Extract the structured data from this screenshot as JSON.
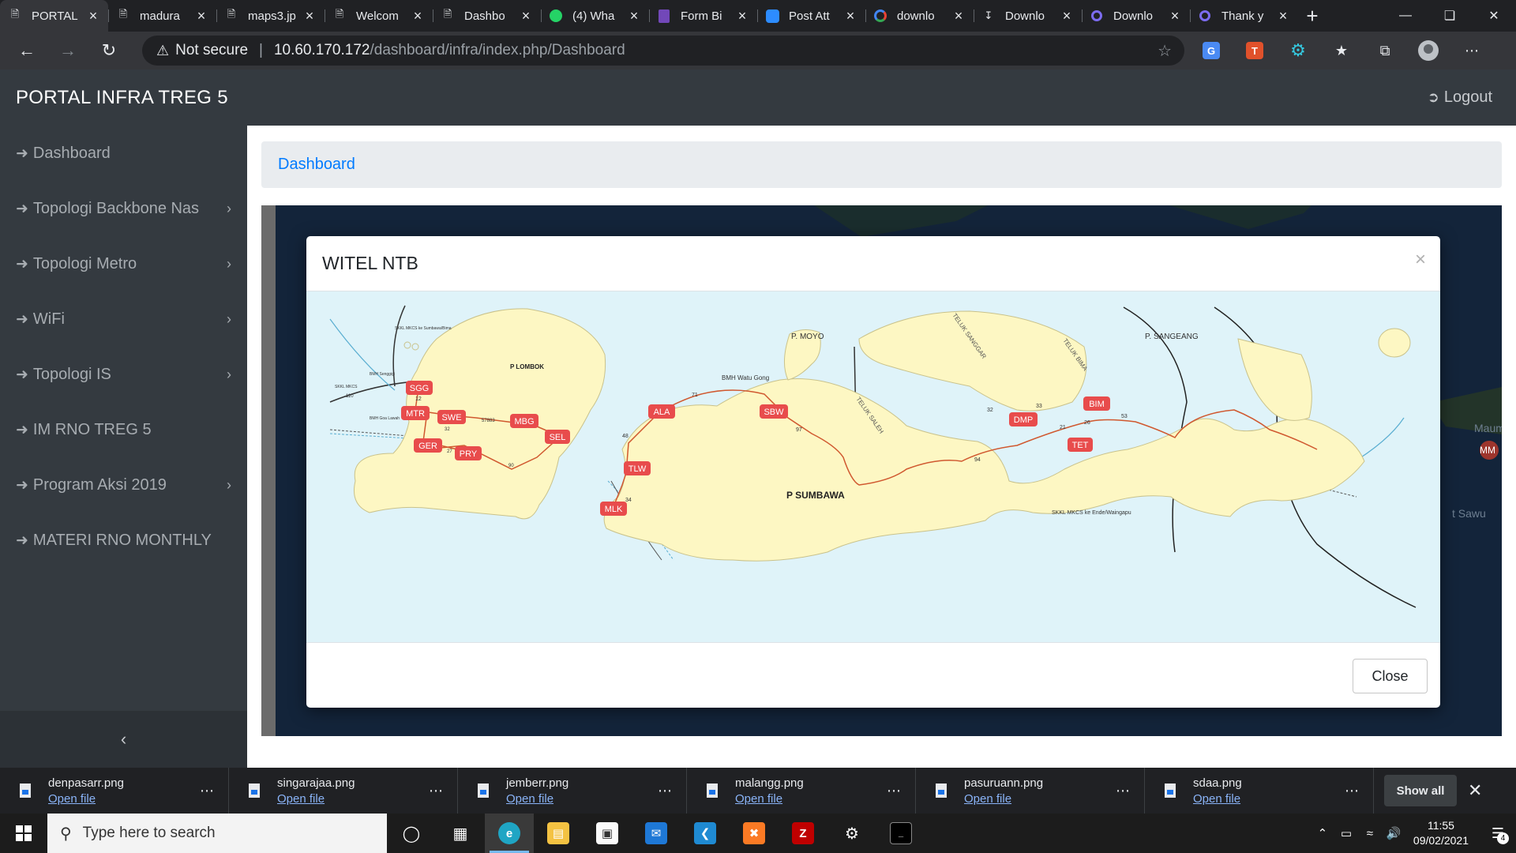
{
  "browser": {
    "tabs": [
      {
        "title": "PORTAL",
        "icon": "page-icon",
        "active": true
      },
      {
        "title": "madura",
        "icon": "page-icon"
      },
      {
        "title": "maps3.jp",
        "icon": "page-icon"
      },
      {
        "title": "Welcom",
        "icon": "page-icon"
      },
      {
        "title": "Dashbo",
        "icon": "page-icon"
      },
      {
        "title": "(4) Wha",
        "icon": "whatsapp-icon"
      },
      {
        "title": "Form Bi",
        "icon": "forms-icon"
      },
      {
        "title": "Post Att",
        "icon": "zoom-icon"
      },
      {
        "title": "downlo",
        "icon": "google-icon"
      },
      {
        "title": "Downlo",
        "icon": "download-icon"
      },
      {
        "title": "Downlo",
        "icon": "app-icon"
      },
      {
        "title": "Thank y",
        "icon": "app-icon"
      }
    ],
    "security_label": "Not secure",
    "url_host": "10.60.170.172",
    "url_path": "/dashboard/infra/index.php/Dashboard"
  },
  "app": {
    "brand": "PORTAL INFRA TREG 5",
    "logout_label": "Logout"
  },
  "sidebar": {
    "items": [
      {
        "label": "Dashboard",
        "has_submenu": false
      },
      {
        "label": "Topologi Backbone Nas",
        "has_submenu": true
      },
      {
        "label": "Topologi Metro",
        "has_submenu": true
      },
      {
        "label": "WiFi",
        "has_submenu": true
      },
      {
        "label": "Topologi IS",
        "has_submenu": true
      },
      {
        "label": "IM RNO TREG 5",
        "has_submenu": false
      },
      {
        "label": "Program Aksi 2019",
        "has_submenu": true
      },
      {
        "label": "MATERI RNO MONTHLY",
        "has_submenu": false
      }
    ]
  },
  "breadcrumb": {
    "label": "Dashboard"
  },
  "background_map": {
    "labels": [
      "Maum",
      "MM",
      "t Sawu"
    ]
  },
  "modal": {
    "title": "WITEL NTB",
    "close_label": "Close",
    "map": {
      "islands": {
        "lombok": "P LOMBOK",
        "sumbawa": "P SUMBAWA",
        "moyo": "P. MOYO",
        "sangeang": "P. SANGEANG"
      },
      "waters": [
        "TELUK SANGGAR",
        "TELUK BIMA",
        "TELUK SALEH"
      ],
      "cable_labels": [
        "SKKL MKCS ke Sumbawa/Bima",
        "BMH Senggigi",
        "SKKL MKCS",
        "BMH Goa Lawah",
        "BMH Watu Gong",
        "SKKL MKCS ke Ende/Waingapu"
      ],
      "nodes": [
        "SGG",
        "MTR",
        "SWE",
        "MBG",
        "SEL",
        "GER",
        "PRY",
        "ALA",
        "SBW",
        "TLW",
        "MLK",
        "DMP",
        "BIM",
        "TET"
      ],
      "link_numbers": [
        "12",
        "110",
        "57883",
        "32",
        "27",
        "90",
        "71",
        "48",
        "34",
        "97",
        "94",
        "32",
        "33",
        "21",
        "26",
        "53"
      ]
    }
  },
  "downloads": {
    "items": [
      {
        "name": "denpasarr.png",
        "action": "Open file"
      },
      {
        "name": "singarajaa.png",
        "action": "Open file"
      },
      {
        "name": "jemberr.png",
        "action": "Open file"
      },
      {
        "name": "malangg.png",
        "action": "Open file"
      },
      {
        "name": "pasuruann.png",
        "action": "Open file"
      },
      {
        "name": "sdaa.png",
        "action": "Open file"
      }
    ],
    "show_all_label": "Show all"
  },
  "taskbar": {
    "search_placeholder": "Type here to search",
    "time": "11:55",
    "date": "09/02/2021",
    "notification_count": "4"
  },
  "colors": {
    "sidebar_bg": "#343a40",
    "link_blue": "#007bff",
    "node_red": "#e84c4c",
    "island_fill": "#fdf7c3",
    "sea": "#dff3f9"
  }
}
